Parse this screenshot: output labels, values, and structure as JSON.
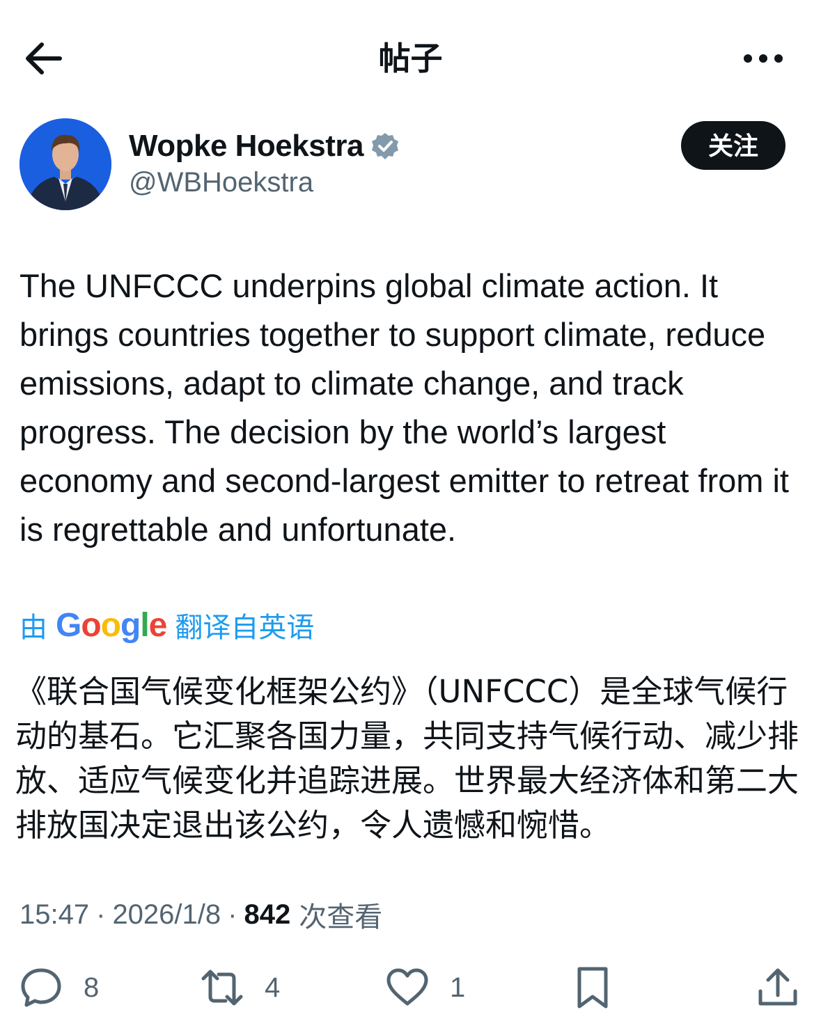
{
  "header": {
    "title": "帖子"
  },
  "author": {
    "display_name": "Wopke Hoekstra",
    "handle": "@WBHoekstra",
    "follow_label": "关注"
  },
  "post": {
    "text": "The UNFCCC underpins global climate action. It brings countries together to support climate, reduce emissions, adapt to climate change, and track progress. The decision by the world’s largest economy and second-largest emitter to retreat from it is regrettable and unfortunate.",
    "translate_prefix": "由",
    "translate_brand": "Google",
    "translate_suffix": "翻译自英语",
    "translated_text": "《联合国气候变化框架公约》（UNFCCC）是全球气候行动的基石。它汇聚各国力量，共同支持气候行动、减少排放、适应气候变化并追踪进展。世界最大经济体和第二大排放国决定退出该公约，令人遗憾和惋惜。",
    "time": "15:47",
    "date": "2026/1/8",
    "separator": "·",
    "views": "842",
    "views_label": "次查看"
  },
  "actions": {
    "replies": "8",
    "reposts": "4",
    "likes": "1"
  },
  "colors": {
    "text": "#0f1419",
    "secondary": "#536471",
    "link": "#1d9bf0",
    "follow_bg": "#0f1419",
    "verified_badge": "#829aab"
  },
  "icons": [
    "back-arrow-icon",
    "more-icon",
    "verified-badge-icon",
    "reply-icon",
    "repost-icon",
    "like-icon",
    "bookmark-icon",
    "share-icon"
  ]
}
